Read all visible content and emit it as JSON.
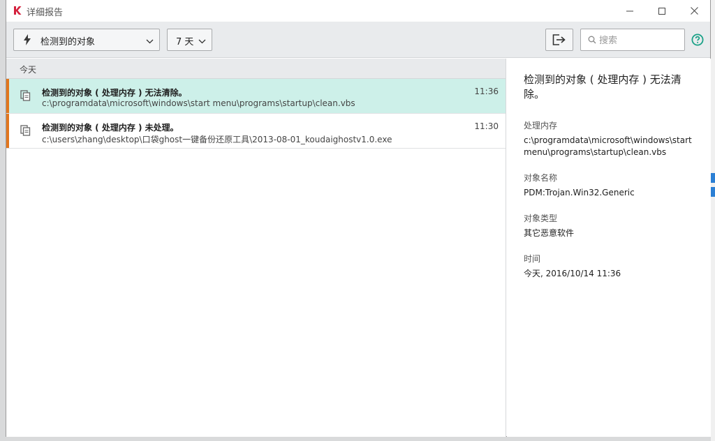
{
  "window": {
    "title": "详细报告",
    "minimize_label": "",
    "maximize_label": "",
    "close_label": ""
  },
  "toolbar": {
    "filter_label": "检测到的对象",
    "period_label": "7 天",
    "search_placeholder": "搜索"
  },
  "list": {
    "group_label": "今天",
    "items": [
      {
        "title": "检测到的对象 ( 处理内存 ) 无法清除。",
        "path": "c:\\programdata\\microsoft\\windows\\start menu\\programs\\startup\\clean.vbs",
        "time": "11:36",
        "selected": true
      },
      {
        "title": "检测到的对象 ( 处理内存 ) 未处理。",
        "path": "c:\\users\\zhang\\desktop\\口袋ghost一键备份还原工具\\2013-08-01_koudaighostv1.0.exe",
        "time": "11:30",
        "selected": false
      }
    ]
  },
  "detail": {
    "title": "检测到的对象 ( 处理内存 ) 无法清除。",
    "fields": [
      {
        "label": "处理内存",
        "value": "c:\\programdata\\microsoft\\windows\\start menu\\programs\\startup\\clean.vbs"
      },
      {
        "label": "对象名称",
        "value": "PDM:Trojan.Win32.Generic"
      },
      {
        "label": "对象类型",
        "value": "其它恶意软件"
      },
      {
        "label": "时间",
        "value": "今天, 2016/10/14 11:36"
      }
    ]
  },
  "colors": {
    "accent_green": "#1aa187",
    "selected_row": "#cdf0e9",
    "severity_marker": "#e2761e",
    "logo_red": "#d4213d"
  },
  "icons": {
    "app_logo": "kaspersky-k-logo",
    "filter": "lightning-bolt-icon",
    "export": "export-icon",
    "search": "search-icon",
    "help": "help-icon",
    "item": "documents-icon"
  }
}
